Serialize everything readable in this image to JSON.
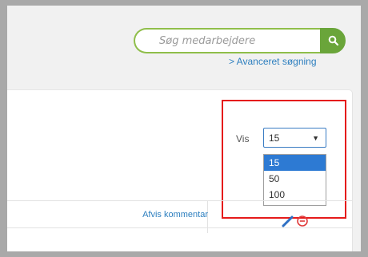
{
  "search": {
    "placeholder": "Søg medarbejdere",
    "button_icon": "search-icon",
    "advanced_link": "> Avanceret søgning"
  },
  "filter": {
    "label": "Vis",
    "selected_value": "15",
    "options": [
      "15",
      "50",
      "100"
    ],
    "selected_option_index": 0
  },
  "table": {
    "column_header": "Afvis kommentar",
    "row_actions": [
      "edit-icon",
      "remove-icon"
    ]
  },
  "colors": {
    "accent_green": "#6aa53a",
    "link_blue": "#2d7fbf",
    "selection_blue": "#2d7ad3",
    "highlight_red": "#e51b1b"
  }
}
